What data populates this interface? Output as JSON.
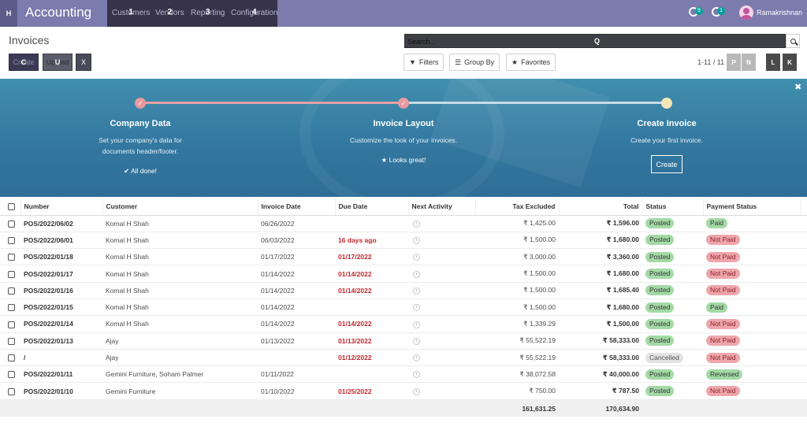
{
  "navbar": {
    "home_key": "H",
    "app_title": "Accounting",
    "menu": [
      {
        "label": "Customers",
        "key": "1"
      },
      {
        "label": "Vendors",
        "key": "2"
      },
      {
        "label": "Reporting",
        "key": "3"
      },
      {
        "label": "Configuration",
        "key": "4"
      }
    ],
    "messages_count": "9",
    "activities_count": "1",
    "user_name": "Ramakrishnan",
    "brand_color": "#7c7bad"
  },
  "control": {
    "breadcrumb": "Invoices",
    "create_label": "Create",
    "create_key": "C",
    "upload_label": "Upload",
    "upload_key": "U",
    "x_key": "X",
    "search_placeholder": "Search...",
    "search_key": "Q",
    "filters_label": "Filters",
    "groupby_label": "Group By",
    "favorites_label": "Favorites",
    "pager": "1-11 / 11",
    "pager_prev_key": "P",
    "pager_next_key": "N",
    "layout_key_l": "L",
    "layout_key_k": "K"
  },
  "onboarding": {
    "steps": [
      {
        "title": "Company Data",
        "desc_line1": "Set your company's data for",
        "desc_line2": "documents header/footer.",
        "done": "All done!",
        "state": "done"
      },
      {
        "title": "Invoice Layout",
        "desc_line1": "Customize the look of your invoices.",
        "desc_line2": "",
        "done": "Looks great!",
        "state": "done"
      },
      {
        "title": "Create Invoice",
        "desc_line1": "Create your first invoice.",
        "desc_line2": "",
        "button": "Create",
        "state": "todo"
      }
    ]
  },
  "table": {
    "headers": {
      "number": "Number",
      "customer": "Customer",
      "invoice_date": "Invoice Date",
      "due_date": "Due Date",
      "next_activity": "Next Activity",
      "tax_excluded": "Tax Excluded",
      "total": "Total",
      "status": "Status",
      "payment_status": "Payment Status"
    },
    "rows": [
      {
        "number": "POS/2022/06/02",
        "customer": "Komal H Shah",
        "invoice_date": "06/26/2022",
        "due_date": "",
        "tax_excluded": "₹ 1,425.00",
        "total": "₹ 1,596.00",
        "status": "Posted",
        "payment": "Paid"
      },
      {
        "number": "POS/2022/06/01",
        "customer": "Komal H Shah",
        "invoice_date": "06/03/2022",
        "due_date": "16 days ago",
        "tax_excluded": "₹ 1,500.00",
        "total": "₹ 1,680.00",
        "status": "Posted",
        "payment": "Not Paid"
      },
      {
        "number": "POS/2022/01/18",
        "customer": "Komal H Shah",
        "invoice_date": "01/17/2022",
        "due_date": "01/17/2022",
        "tax_excluded": "₹ 3,000.00",
        "total": "₹ 3,360.00",
        "status": "Posted",
        "payment": "Not Paid"
      },
      {
        "number": "POS/2022/01/17",
        "customer": "Komal H Shah",
        "invoice_date": "01/14/2022",
        "due_date": "01/14/2022",
        "tax_excluded": "₹ 1,500.00",
        "total": "₹ 1,680.00",
        "status": "Posted",
        "payment": "Not Paid"
      },
      {
        "number": "POS/2022/01/16",
        "customer": "Komal H Shah",
        "invoice_date": "01/14/2022",
        "due_date": "01/14/2022",
        "tax_excluded": "₹ 1,500.00",
        "total": "₹ 1,685.40",
        "status": "Posted",
        "payment": "Not Paid"
      },
      {
        "number": "POS/2022/01/15",
        "customer": "Komal H Shah",
        "invoice_date": "01/14/2022",
        "due_date": "",
        "tax_excluded": "₹ 1,500.00",
        "total": "₹ 1,680.00",
        "status": "Posted",
        "payment": "Paid"
      },
      {
        "number": "POS/2022/01/14",
        "customer": "Komal H Shah",
        "invoice_date": "01/14/2022",
        "due_date": "01/14/2022",
        "tax_excluded": "₹ 1,339.29",
        "total": "₹ 1,500.00",
        "status": "Posted",
        "payment": "Not Paid"
      },
      {
        "number": "POS/2022/01/13",
        "customer": "Ajay",
        "invoice_date": "01/13/2022",
        "due_date": "01/13/2022",
        "tax_excluded": "₹ 55,522.19",
        "total": "₹ 58,333.00",
        "status": "Posted",
        "payment": "Not Paid"
      },
      {
        "number": "/",
        "customer": "Ajay",
        "invoice_date": "",
        "due_date": "01/12/2022",
        "tax_excluded": "₹ 55,522.19",
        "total": "₹ 58,333.00",
        "status": "Cancelled",
        "payment": "Not Paid"
      },
      {
        "number": "POS/2022/01/11",
        "customer": "Gemini Furniture, Soham Palmer",
        "invoice_date": "01/11/2022",
        "due_date": "",
        "tax_excluded": "₹ 38,072.58",
        "total": "₹ 40,000.00",
        "status": "Posted",
        "payment": "Reversed"
      },
      {
        "number": "POS/2022/01/10",
        "customer": "Gemini Furniture",
        "invoice_date": "01/10/2022",
        "due_date": "01/25/2022",
        "tax_excluded": "₹ 750.00",
        "total": "₹ 787.50",
        "status": "Posted",
        "payment": "Not Paid"
      }
    ],
    "footer": {
      "tax_excluded": "161,631.25",
      "total": "170,634.90"
    }
  }
}
